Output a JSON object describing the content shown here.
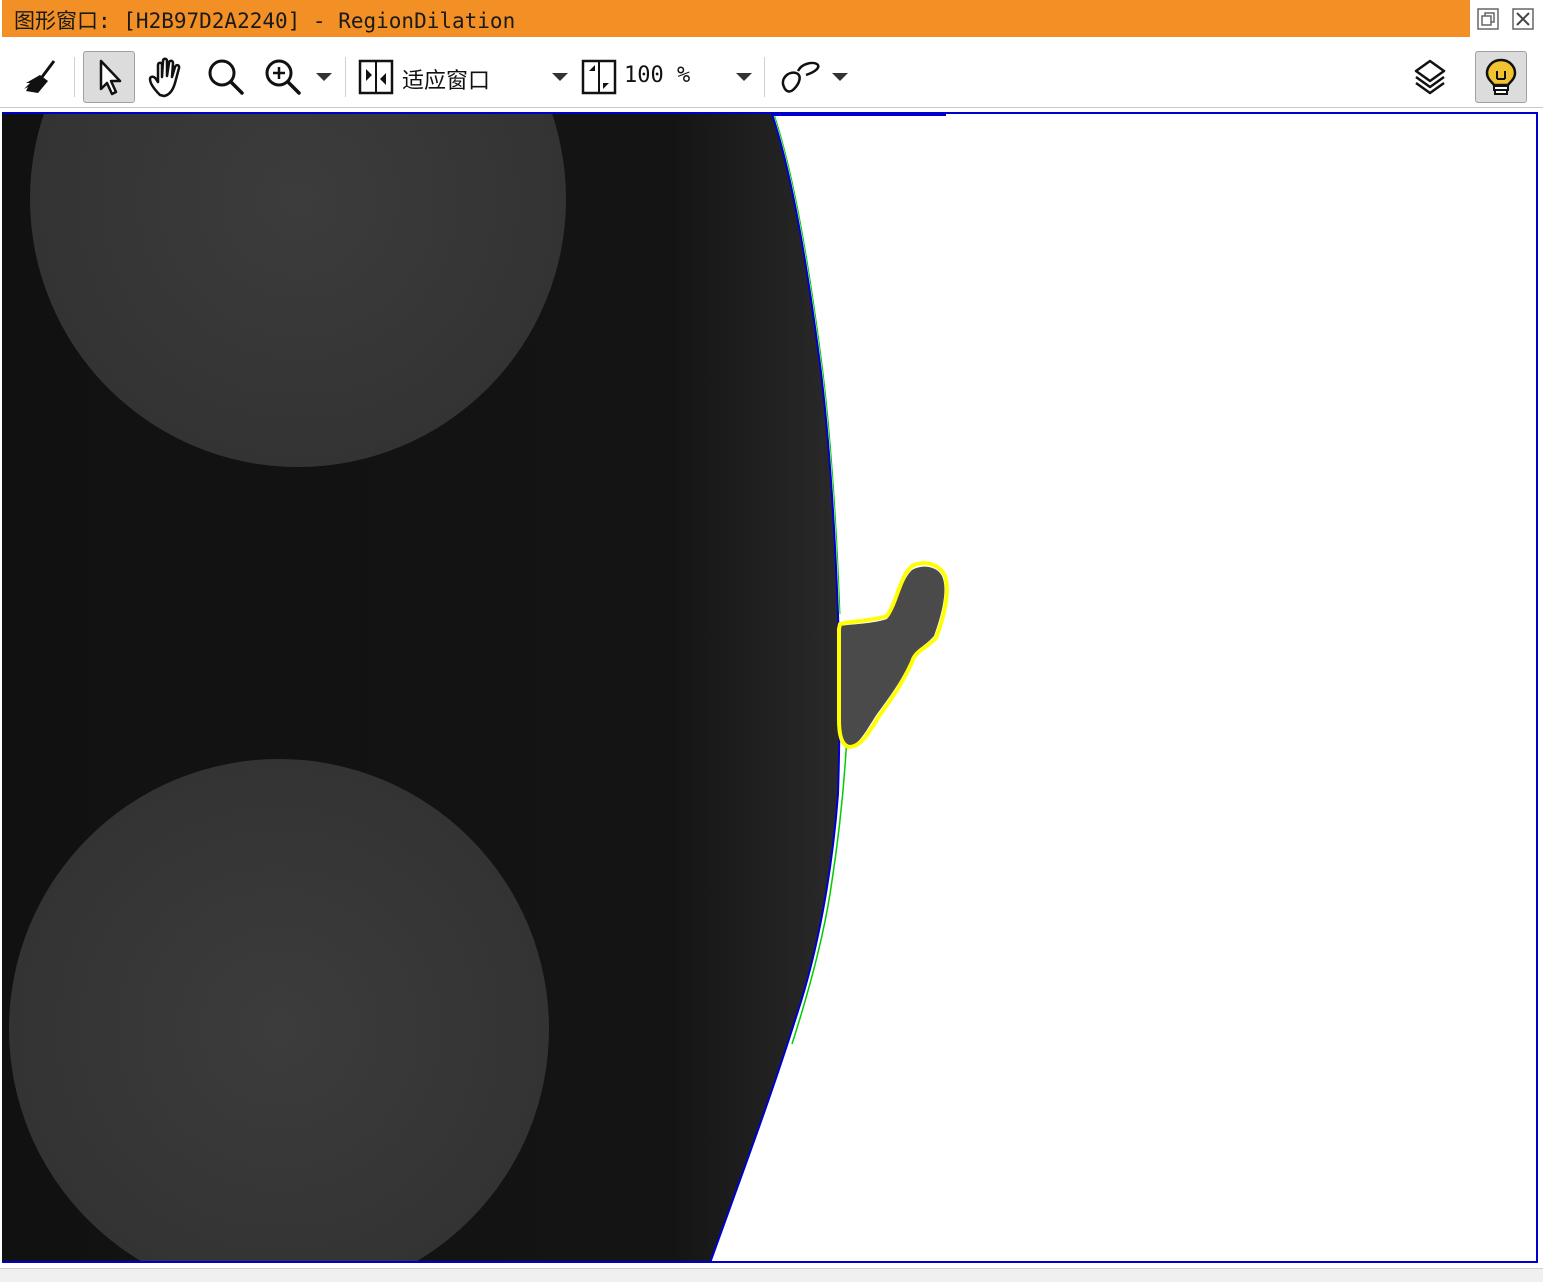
{
  "window": {
    "title": "图形窗口: [H2B97D2A2240] - RegionDilation",
    "title_bar_color": "#f28f25",
    "buttons": [
      {
        "name": "restore",
        "icon": "restore-icon"
      },
      {
        "name": "close",
        "icon": "close-icon"
      }
    ]
  },
  "toolbar": {
    "tools": [
      {
        "name": "clear",
        "icon": "broom-icon",
        "active": false
      },
      {
        "name": "select",
        "icon": "pointer-icon",
        "active": true
      },
      {
        "name": "pan",
        "icon": "hand-icon",
        "active": false
      },
      {
        "name": "magnify",
        "icon": "magnifier-icon",
        "active": false
      },
      {
        "name": "zoom",
        "icon": "zoom-in-icon",
        "active": false,
        "has_dropdown": true
      }
    ],
    "fit_window_label": "适应窗口",
    "zoom_level": "100 %",
    "draw_shape_icon": "draw-shape-icon",
    "layers_icon": "layers-icon",
    "lightbulb_icon": "lightbulb-icon",
    "lightbulb_color": "#f2c230"
  },
  "image_view": {
    "region_outline_color": "#ffff00",
    "edge_contour_color": "#00cc00",
    "frame_color": "#0000cc",
    "background_color": "#111111"
  }
}
